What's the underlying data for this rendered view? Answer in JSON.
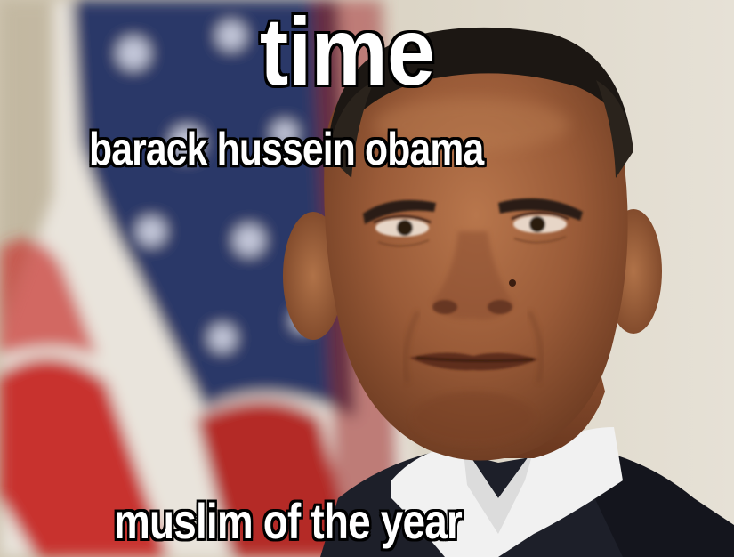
{
  "meme": {
    "top_text": "time",
    "sub_text": "barack hussein obama",
    "bottom_text": "muslim of the year"
  },
  "colors": {
    "caption_fill": "#ffffff",
    "caption_outline": "#000000",
    "flag_red": "#c8322e",
    "flag_blue": "#2a3868",
    "flag_white": "#ece8e2",
    "background_wall": "#d9d3c4",
    "suit": "#1d1f29",
    "shirt": "#f1f1f1",
    "skin": "#a5663f"
  },
  "icons": [
    "american-flag-image",
    "man-portrait-image"
  ]
}
